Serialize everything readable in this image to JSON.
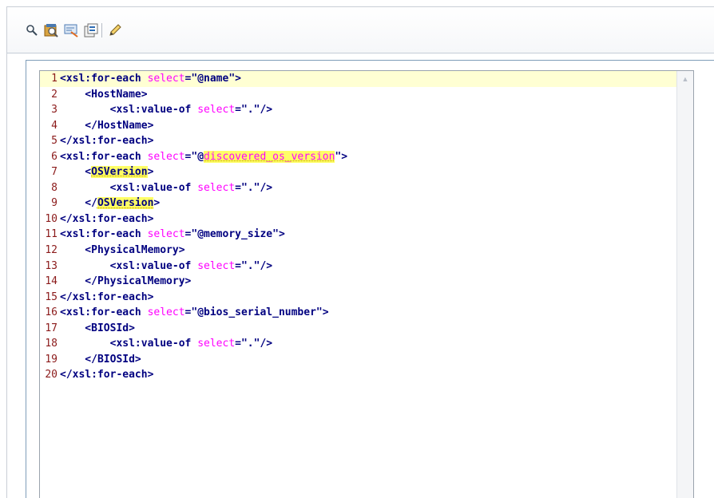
{
  "toolbar": {
    "buttons": [
      {
        "name": "search-icon",
        "title": "Find"
      },
      {
        "name": "replace-icon",
        "title": "Replace"
      },
      {
        "name": "goto-line-icon",
        "title": "Go to line"
      },
      {
        "name": "properties-icon",
        "title": "Properties"
      },
      {
        "name": "edit-pencil-icon",
        "title": "Edit"
      }
    ]
  },
  "colors": {
    "line_number": "#8b1a1a",
    "tag": "#000080",
    "attribute": "#ff00ff",
    "active_line": "#ffffd3",
    "highlight": "#ffff66"
  },
  "editor": {
    "lines": [
      {
        "n": "1",
        "segments": [
          {
            "t": "<xsl:for-each ",
            "c": "txt"
          },
          {
            "t": "select",
            "c": "attr"
          },
          {
            "t": "=\"@name\">",
            "c": "str"
          }
        ],
        "active": true
      },
      {
        "n": "2",
        "segments": [
          {
            "t": "    <HostName>",
            "c": "txt"
          }
        ]
      },
      {
        "n": "3",
        "segments": [
          {
            "t": "        <xsl:value-of ",
            "c": "txt"
          },
          {
            "t": "select",
            "c": "attr"
          },
          {
            "t": "=\".\"/>",
            "c": "str"
          }
        ]
      },
      {
        "n": "4",
        "segments": [
          {
            "t": "    </HostName>",
            "c": "txt"
          }
        ]
      },
      {
        "n": "5",
        "segments": [
          {
            "t": "</xsl:for-each>",
            "c": "txt"
          }
        ]
      },
      {
        "n": "6",
        "segments": [
          {
            "t": "<xsl:for-each ",
            "c": "txt"
          },
          {
            "t": "select",
            "c": "attr"
          },
          {
            "t": "=\"@",
            "c": "str"
          },
          {
            "t": "discovered_os_version",
            "c": "hl attrhl"
          },
          {
            "t": "\">",
            "c": "str"
          }
        ]
      },
      {
        "n": "7",
        "segments": [
          {
            "t": "    <",
            "c": "txt"
          },
          {
            "t": "OSVersion",
            "c": "hl txt"
          },
          {
            "t": ">",
            "c": "txt"
          }
        ]
      },
      {
        "n": "8",
        "segments": [
          {
            "t": "        <xsl:value-of ",
            "c": "txt"
          },
          {
            "t": "select",
            "c": "attr"
          },
          {
            "t": "=\".\"/>",
            "c": "str"
          }
        ]
      },
      {
        "n": "9",
        "segments": [
          {
            "t": "    </",
            "c": "txt"
          },
          {
            "t": "OSVersion",
            "c": "hl txt"
          },
          {
            "t": ">",
            "c": "txt"
          }
        ]
      },
      {
        "n": "10",
        "segments": [
          {
            "t": "</xsl:for-each>",
            "c": "txt"
          }
        ]
      },
      {
        "n": "11",
        "segments": [
          {
            "t": "<xsl:for-each ",
            "c": "txt"
          },
          {
            "t": "select",
            "c": "attr"
          },
          {
            "t": "=\"@memory_size\">",
            "c": "str"
          }
        ]
      },
      {
        "n": "12",
        "segments": [
          {
            "t": "    <PhysicalMemory>",
            "c": "txt"
          }
        ]
      },
      {
        "n": "13",
        "segments": [
          {
            "t": "        <xsl:value-of ",
            "c": "txt"
          },
          {
            "t": "select",
            "c": "attr"
          },
          {
            "t": "=\".\"/>",
            "c": "str"
          }
        ]
      },
      {
        "n": "14",
        "segments": [
          {
            "t": "    </PhysicalMemory>",
            "c": "txt"
          }
        ]
      },
      {
        "n": "15",
        "segments": [
          {
            "t": "</xsl:for-each>",
            "c": "txt"
          }
        ]
      },
      {
        "n": "16",
        "segments": [
          {
            "t": "<xsl:for-each ",
            "c": "txt"
          },
          {
            "t": "select",
            "c": "attr"
          },
          {
            "t": "=\"@bios_serial_number\">",
            "c": "str"
          }
        ]
      },
      {
        "n": "17",
        "segments": [
          {
            "t": "    <BIOSId>",
            "c": "txt"
          }
        ]
      },
      {
        "n": "18",
        "segments": [
          {
            "t": "        <xsl:value-of ",
            "c": "txt"
          },
          {
            "t": "select",
            "c": "attr"
          },
          {
            "t": "=\".\"/>",
            "c": "str"
          }
        ]
      },
      {
        "n": "19",
        "segments": [
          {
            "t": "    </BIOSId>",
            "c": "txt"
          }
        ]
      },
      {
        "n": "20",
        "segments": [
          {
            "t": "</xsl:for-each>",
            "c": "txt"
          }
        ]
      }
    ]
  }
}
